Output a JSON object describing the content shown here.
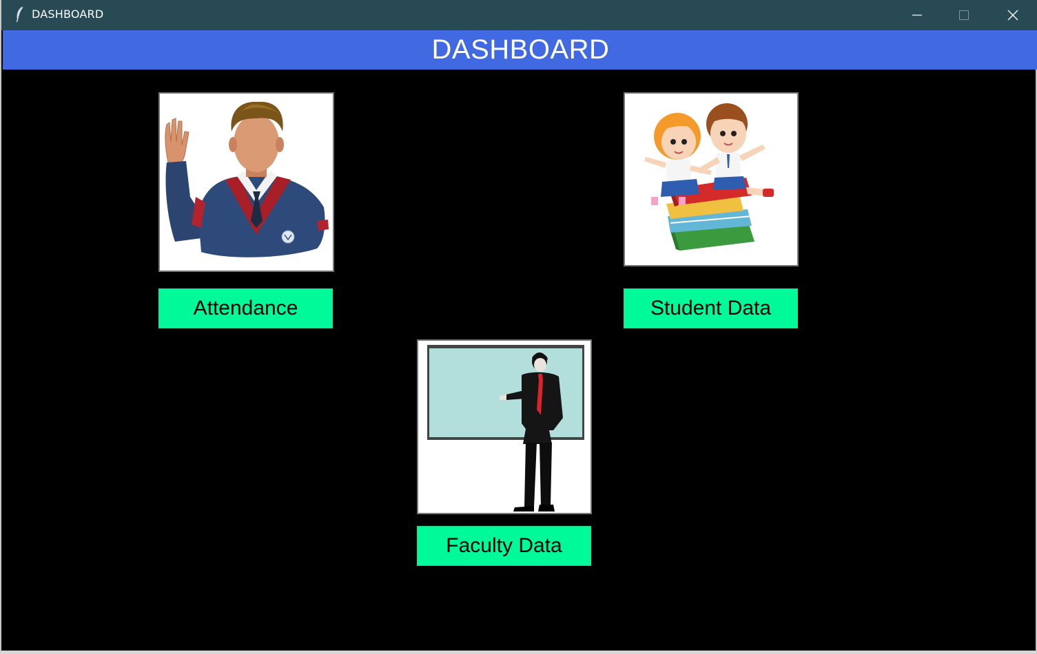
{
  "window": {
    "title": "DASHBOARD",
    "controls": [
      "minimize-icon",
      "maximize-icon",
      "close-icon"
    ]
  },
  "header": {
    "title": "DASHBOARD",
    "color": "#4169e1"
  },
  "cards": [
    {
      "image": "student-raising-hand-image",
      "button_label": "Attendance"
    },
    {
      "image": "kids-on-books-image",
      "button_label": "Student Data"
    },
    {
      "image": "teacher-at-whiteboard-image",
      "button_label": "Faculty Data"
    }
  ],
  "colors": {
    "titlebar": "#284a55",
    "background": "#000000",
    "button": "#00fa9a"
  }
}
